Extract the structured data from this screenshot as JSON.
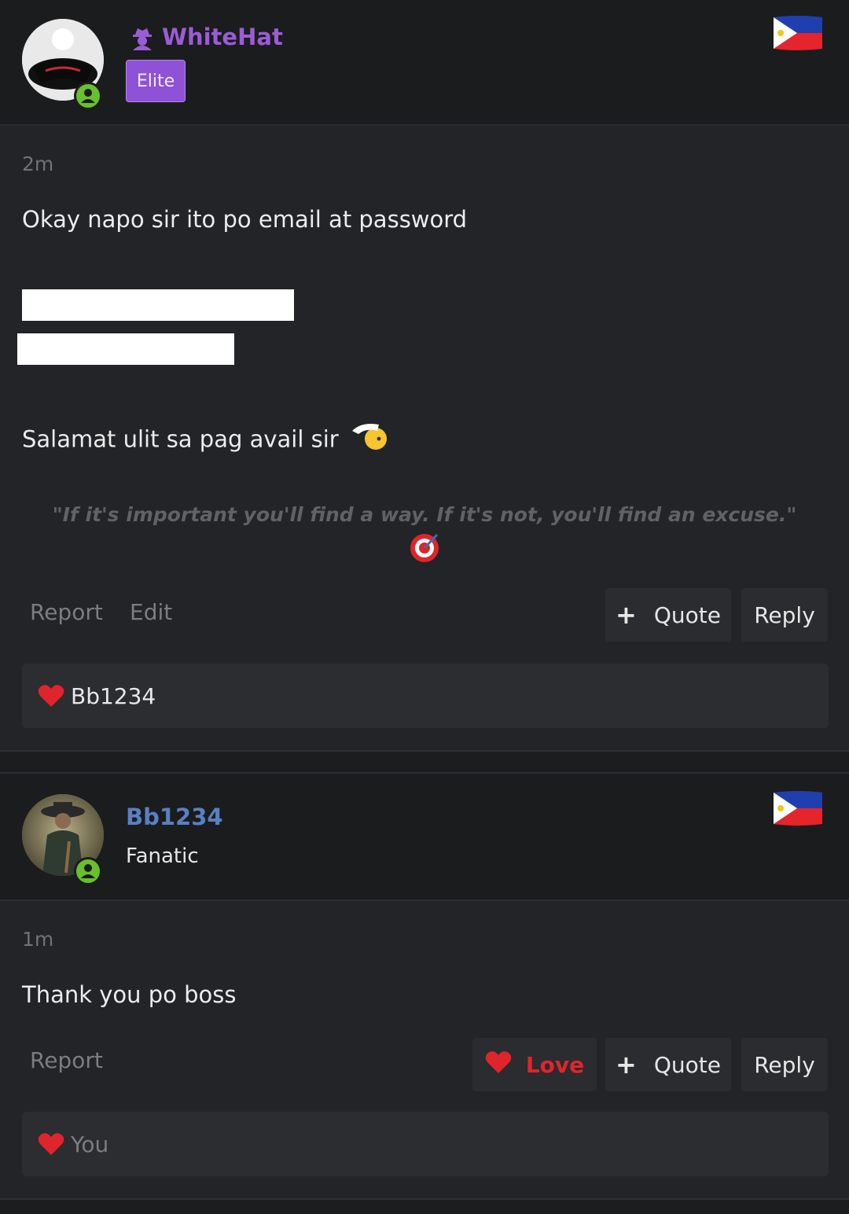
{
  "posts": [
    {
      "username": "WhiteHat",
      "username_color": "#9b5cd6",
      "rank": "Elite",
      "rank_color": "#8f52d6",
      "timestamp": "2m",
      "message_line1": "Okay napo sir ito po email at password",
      "message_line2": "Salamat ulit sa pag avail sir",
      "signature": "\"If it's important you'll find a way. If it's not, you'll find an excuse.\"",
      "actions": {
        "report": "Report",
        "edit": "Edit",
        "quote": "Quote",
        "reply": "Reply"
      },
      "reactions_by": "Bb1234"
    },
    {
      "username": "Bb1234",
      "username_color": "#5a7fc2",
      "rank": "Fanatic",
      "timestamp": "1m",
      "message_line1": "Thank you po boss",
      "actions": {
        "report": "Report",
        "love": "Love",
        "quote": "Quote",
        "reply": "Reply"
      },
      "reactions_by": "You"
    }
  ],
  "colors": {
    "online": "#67c12c",
    "love": "#e0242b"
  }
}
